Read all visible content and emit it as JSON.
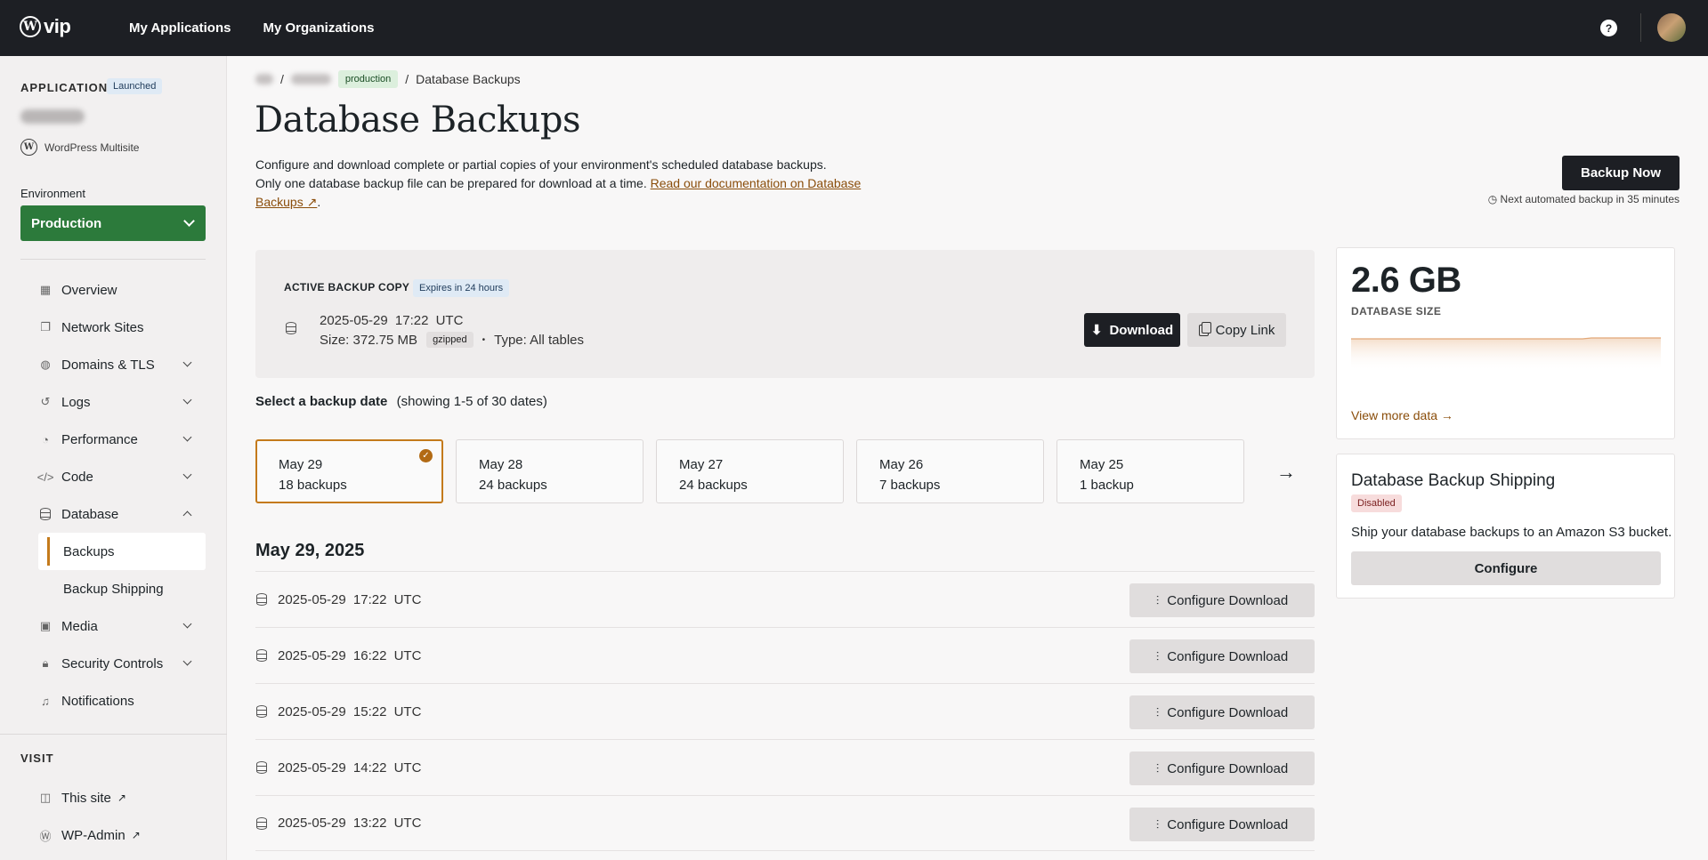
{
  "topbar": {
    "logo_text": "vip",
    "nav": [
      "My Applications",
      "My Organizations"
    ],
    "help_label": "?"
  },
  "sidebar": {
    "app_label": "APPLICATION",
    "app_status": "Launched",
    "app_type": "WordPress Multisite",
    "env_label": "Environment",
    "env_value": "Production",
    "items": [
      {
        "label": "Overview",
        "icon": "grid-icon"
      },
      {
        "label": "Network Sites",
        "icon": "window-icon"
      },
      {
        "label": "Domains & TLS",
        "icon": "globe-icon"
      },
      {
        "label": "Logs",
        "icon": "history-icon"
      },
      {
        "label": "Performance",
        "icon": "gauge-icon"
      },
      {
        "label": "Code",
        "icon": "code-icon"
      },
      {
        "label": "Database",
        "icon": "database-icon"
      },
      {
        "label": "Media",
        "icon": "image-icon"
      },
      {
        "label": "Security Controls",
        "icon": "lock-icon"
      },
      {
        "label": "Notifications",
        "icon": "bell-icon"
      }
    ],
    "sub_items": [
      "Backups",
      "Backup Shipping"
    ],
    "visit_label": "VISIT",
    "visit_items": [
      "This site",
      "WP-Admin"
    ]
  },
  "breadcrumb": {
    "env_badge": "production",
    "current": "Database Backups"
  },
  "page": {
    "title": "Database Backups",
    "intro_1": "Configure and download complete or partial copies of your environment's scheduled database backups.",
    "intro_2": "Only one database backup file can be prepared for download at a time.",
    "intro_link": "Read our documentation on Database Backups ↗",
    "backup_now": "Backup Now",
    "next_auto": "Next automated backup in 35 minutes"
  },
  "active_backup": {
    "label": "ACTIVE BACKUP COPY",
    "expires": "Expires in 24 hours",
    "date": "2025-05-29  17:22 UTC",
    "size": "Size: 372.75 MB",
    "format": "gzipped",
    "type": "Type: All tables",
    "download": "Download",
    "copy_link": "Copy Link"
  },
  "date_select": {
    "label": "Select a backup date",
    "showing": "(showing 1-5 of 30 dates)",
    "dates": [
      {
        "day": "May 29",
        "count": "18 backups"
      },
      {
        "day": "May 28",
        "count": "24 backups"
      },
      {
        "day": "May 27",
        "count": "24 backups"
      },
      {
        "day": "May 26",
        "count": "7 backups"
      },
      {
        "day": "May 25",
        "count": "1 backup"
      }
    ]
  },
  "backups": {
    "heading": "May 29, 2025",
    "button_label": "Configure Download",
    "rows": [
      "2025-05-29  17:22 UTC",
      "2025-05-29  16:22 UTC",
      "2025-05-29  15:22 UTC",
      "2025-05-29  14:22 UTC",
      "2025-05-29  13:22 UTC"
    ]
  },
  "db_size": {
    "value": "2.6 GB",
    "label": "DATABASE SIZE",
    "link": "View more data →"
  },
  "shipping": {
    "title": "Database Backup Shipping",
    "status": "Disabled",
    "desc": "Ship your database backups to an Amazon S3 bucket.",
    "button": "Configure"
  },
  "colors": {
    "accent": "#c47a1b",
    "env_green": "#2c7a3b",
    "dark": "#1d1f24"
  }
}
